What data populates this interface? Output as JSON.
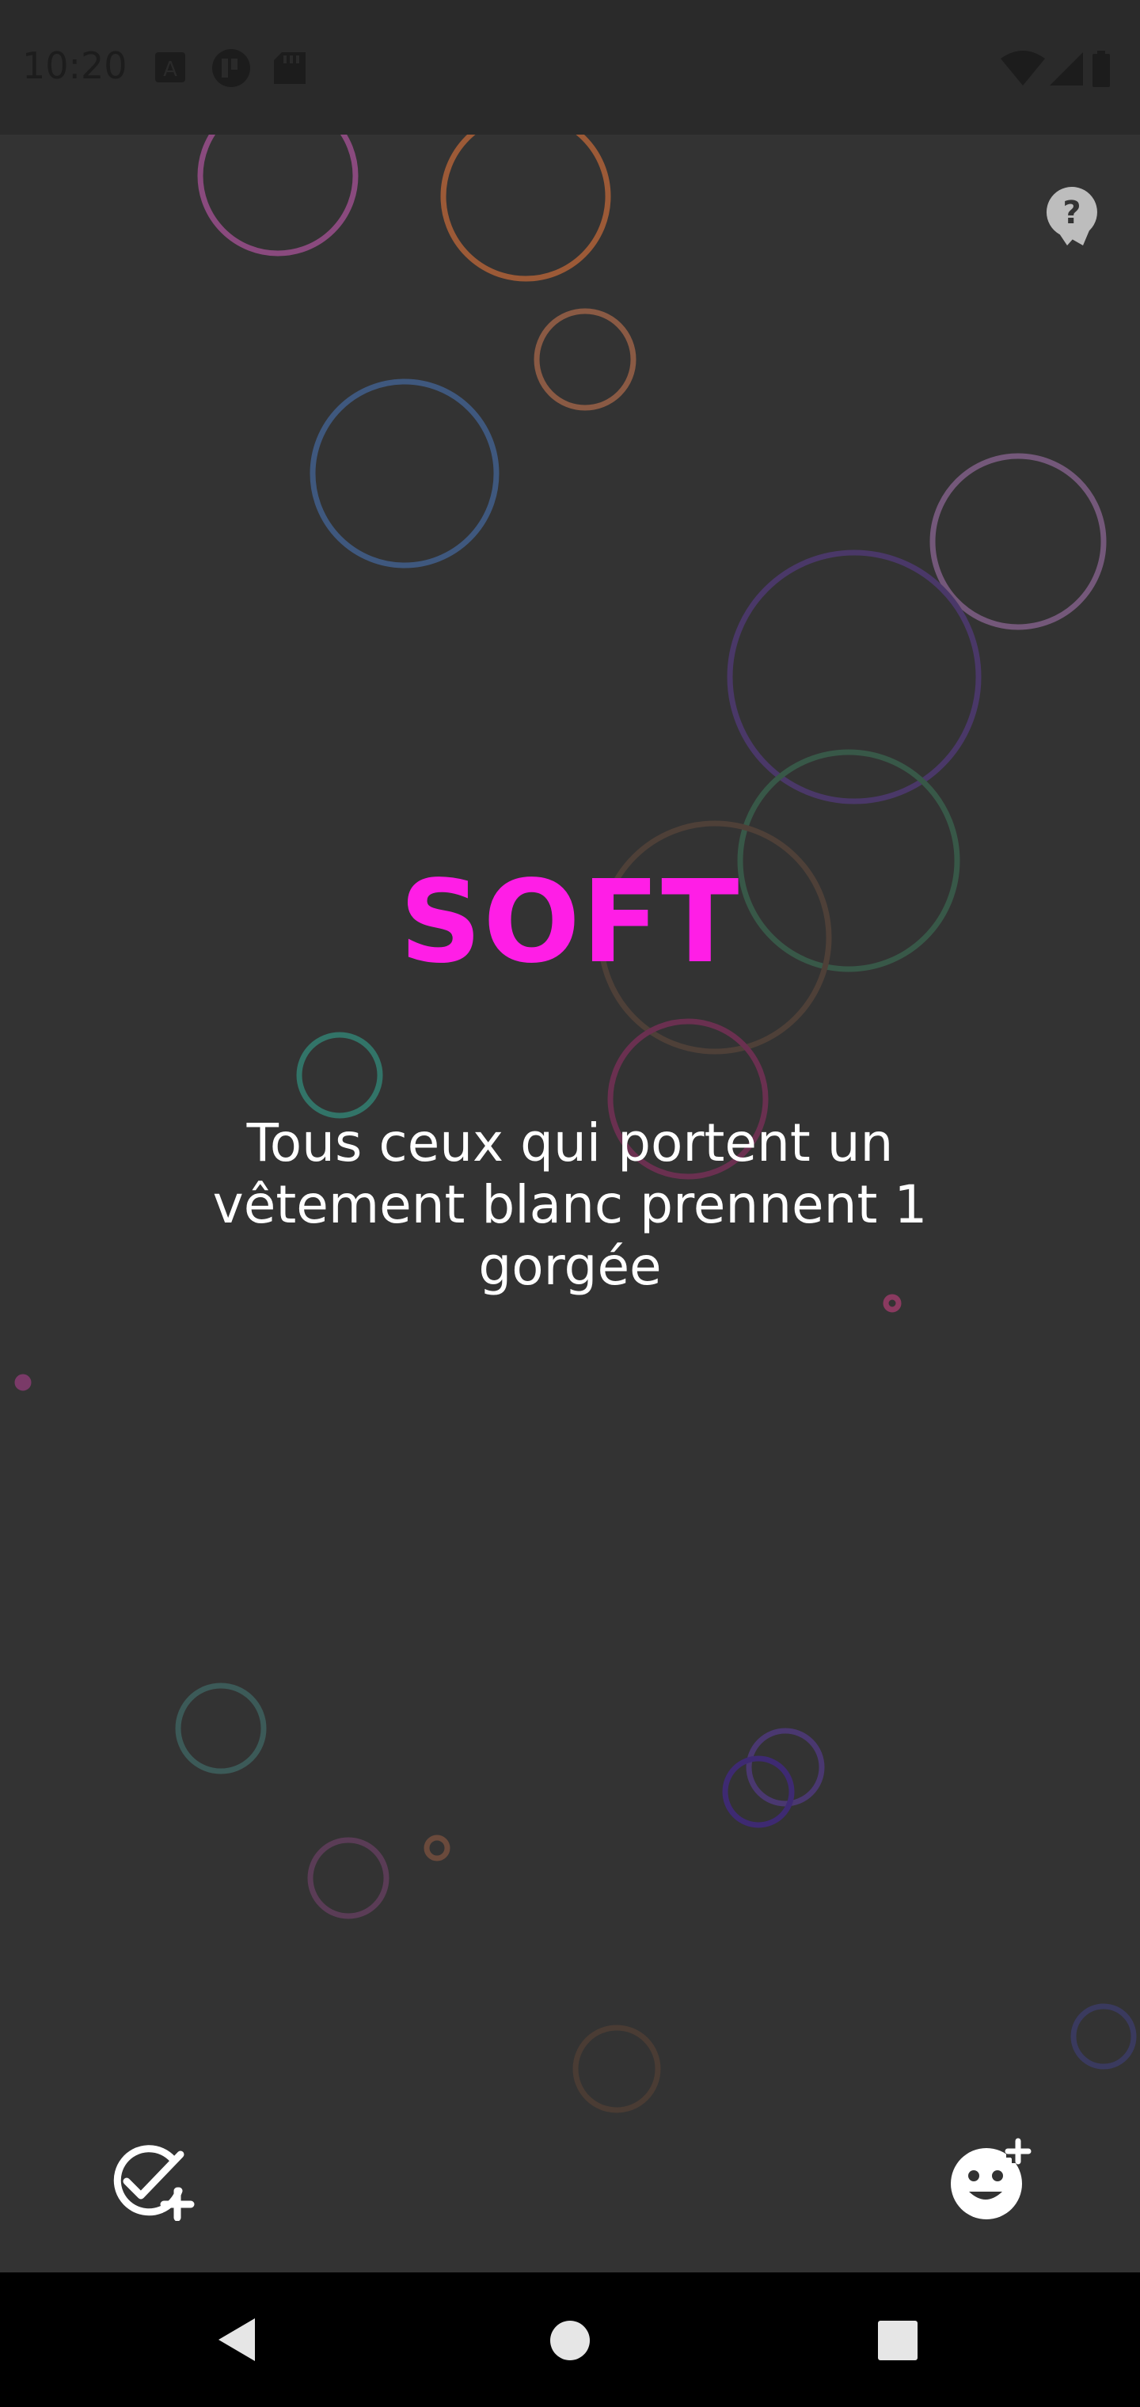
{
  "status_bar": {
    "time": "10:20"
  },
  "game": {
    "mode_title": "SOFT",
    "mode_color": "#ff1ee6",
    "card_lines": [
      "Tous ceux qui portent un",
      "vêtement blanc prennent 1",
      "gorgée"
    ]
  },
  "icons": {
    "help": "help-icon",
    "add_card": "check-plus-icon",
    "add_player": "smiley-plus-icon",
    "nav_back": "back-triangle-icon",
    "nav_home": "home-circle-icon",
    "nav_recents": "recents-square-icon"
  },
  "colors": {
    "background": "#333333",
    "status_bar": "#2a2a2a",
    "nav_bar": "#000000",
    "text": "#ffffff",
    "accent": "#ff1ee6"
  }
}
